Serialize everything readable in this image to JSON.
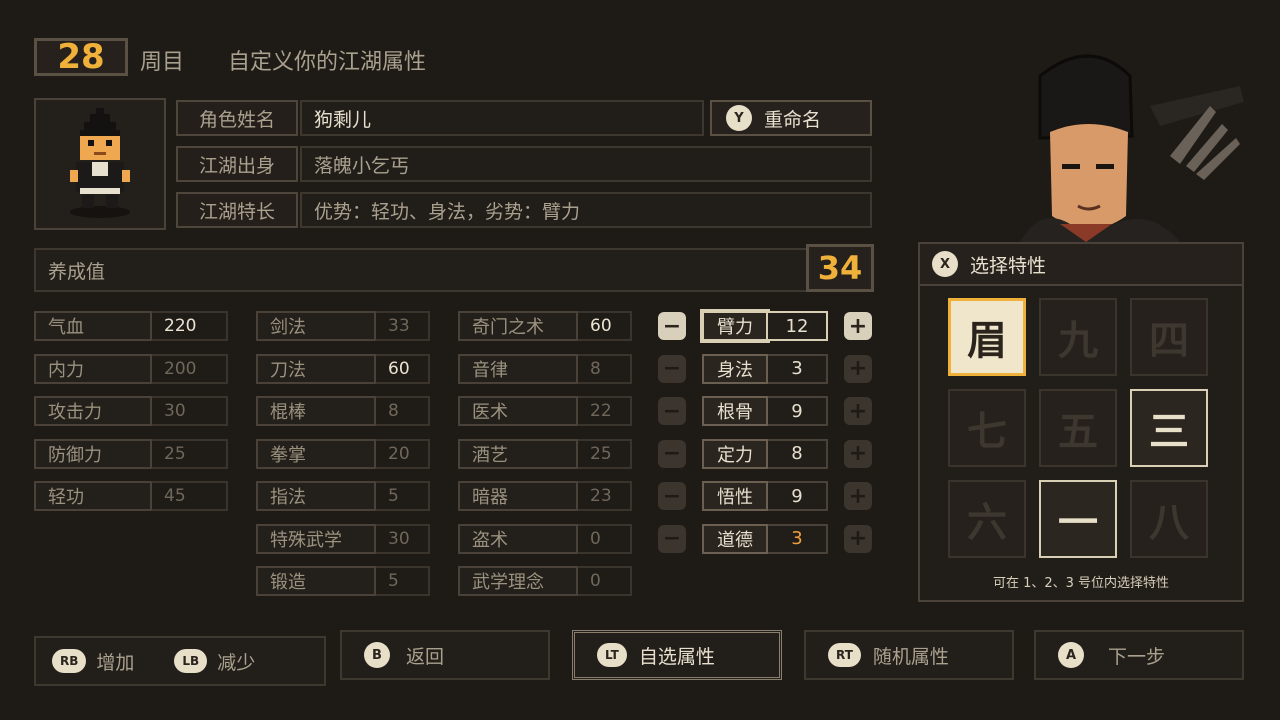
{
  "header": {
    "cycle_number": "28",
    "cycle_label": "周目",
    "description": "自定义你的江湖属性"
  },
  "profile": {
    "rows": [
      {
        "label": "角色姓名",
        "value": "狗剩儿"
      },
      {
        "label": "江湖出身",
        "value": "落魄小乞丐"
      },
      {
        "label": "江湖特长",
        "value": "优势：轻功、身法，劣势：臂力"
      }
    ],
    "rename": {
      "key": "Y",
      "label": "重命名"
    }
  },
  "growth": {
    "label": "养成值",
    "value": "34"
  },
  "stats_col1": [
    {
      "label": "气血",
      "value": "220",
      "hi": true
    },
    {
      "label": "内力",
      "value": "200",
      "hi": false
    },
    {
      "label": "攻击力",
      "value": "30",
      "hi": false
    },
    {
      "label": "防御力",
      "value": "25",
      "hi": false
    },
    {
      "label": "轻功",
      "value": "45",
      "hi": false
    }
  ],
  "stats_col2": [
    {
      "label": "剑法",
      "value": "33",
      "hi": false
    },
    {
      "label": "刀法",
      "value": "60",
      "hi": true
    },
    {
      "label": "棍棒",
      "value": "8",
      "hi": false
    },
    {
      "label": "拳掌",
      "value": "20",
      "hi": false
    },
    {
      "label": "指法",
      "value": "5",
      "hi": false
    },
    {
      "label": "特殊武学",
      "value": "30",
      "hi": false
    },
    {
      "label": "锻造",
      "value": "5",
      "hi": false
    }
  ],
  "stats_col3": [
    {
      "label": "奇门之术",
      "value": "60",
      "hi": true
    },
    {
      "label": "音律",
      "value": "8",
      "hi": false
    },
    {
      "label": "医术",
      "value": "22",
      "hi": false
    },
    {
      "label": "酒艺",
      "value": "25",
      "hi": false
    },
    {
      "label": "暗器",
      "value": "23",
      "hi": false
    },
    {
      "label": "盗术",
      "value": "0",
      "hi": false
    },
    {
      "label": "武学理念",
      "value": "0",
      "hi": false
    }
  ],
  "attributes": [
    {
      "label": "臂力",
      "value": "12",
      "active": true
    },
    {
      "label": "身法",
      "value": "3",
      "active": false
    },
    {
      "label": "根骨",
      "value": "9",
      "active": false
    },
    {
      "label": "定力",
      "value": "8",
      "active": false
    },
    {
      "label": "悟性",
      "value": "9",
      "active": false
    },
    {
      "label": "道德",
      "value": "3",
      "active": false,
      "orange": true
    }
  ],
  "traits": {
    "key": "X",
    "title": "选择特性",
    "tiles": [
      {
        "glyph": "眉",
        "state": "pick"
      },
      {
        "glyph": "九",
        "state": "dim"
      },
      {
        "glyph": "四",
        "state": "dim"
      },
      {
        "glyph": "七",
        "state": "dim"
      },
      {
        "glyph": "五",
        "state": "dim"
      },
      {
        "glyph": "三",
        "state": "sel"
      },
      {
        "glyph": "六",
        "state": "dim"
      },
      {
        "glyph": "一",
        "state": "sel"
      },
      {
        "glyph": "八",
        "state": "dim"
      }
    ],
    "hint": "可在 1、2、3 号位内选择特性"
  },
  "bottom": {
    "inc_key": "RB",
    "inc_label": "增加",
    "dec_key": "LB",
    "dec_label": "减少",
    "back_key": "B",
    "back_label": "返回",
    "custom_key": "LT",
    "custom_label": "自选属性",
    "random_key": "RT",
    "random_label": "随机属性",
    "next_key": "A",
    "next_label": "下一步"
  }
}
